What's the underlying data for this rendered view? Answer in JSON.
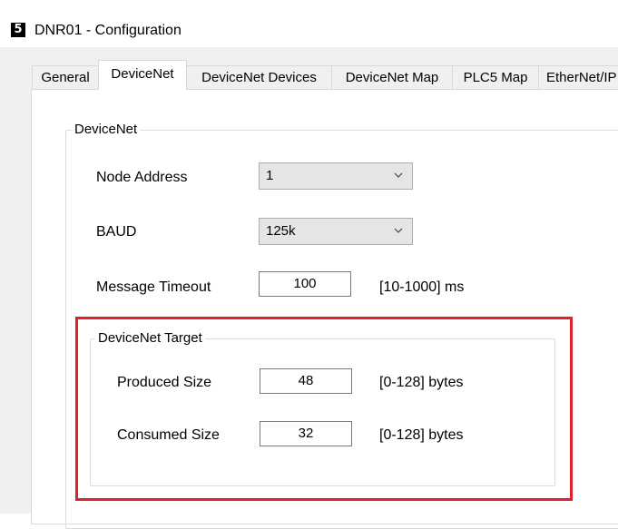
{
  "window": {
    "title": "DNR01 - Configuration",
    "icon_glyph": "5"
  },
  "tabs": [
    {
      "label": "General",
      "active": false
    },
    {
      "label": "DeviceNet",
      "active": true
    },
    {
      "label": "DeviceNet Devices",
      "active": false
    },
    {
      "label": "DeviceNet Map",
      "active": false
    },
    {
      "label": "PLC5 Map",
      "active": false
    },
    {
      "label": "EtherNet/IP",
      "active": false
    }
  ],
  "devicenet": {
    "group_label": "DeviceNet",
    "node_address": {
      "label": "Node Address",
      "value": "1"
    },
    "baud": {
      "label": "BAUD",
      "value": "125k"
    },
    "message_timeout": {
      "label": "Message Timeout",
      "value": "100",
      "range": "[10-1000] ms"
    }
  },
  "target": {
    "group_label": "DeviceNet Target",
    "produced_size": {
      "label": "Produced Size",
      "value": "48",
      "range": "[0-128] bytes"
    },
    "consumed_size": {
      "label": "Consumed Size",
      "value": "32",
      "range": "[0-128] bytes"
    }
  },
  "colors": {
    "highlight": "#e0202a",
    "tab_bg": "#f0f0f0",
    "combo_bg": "#e5e5e5"
  }
}
